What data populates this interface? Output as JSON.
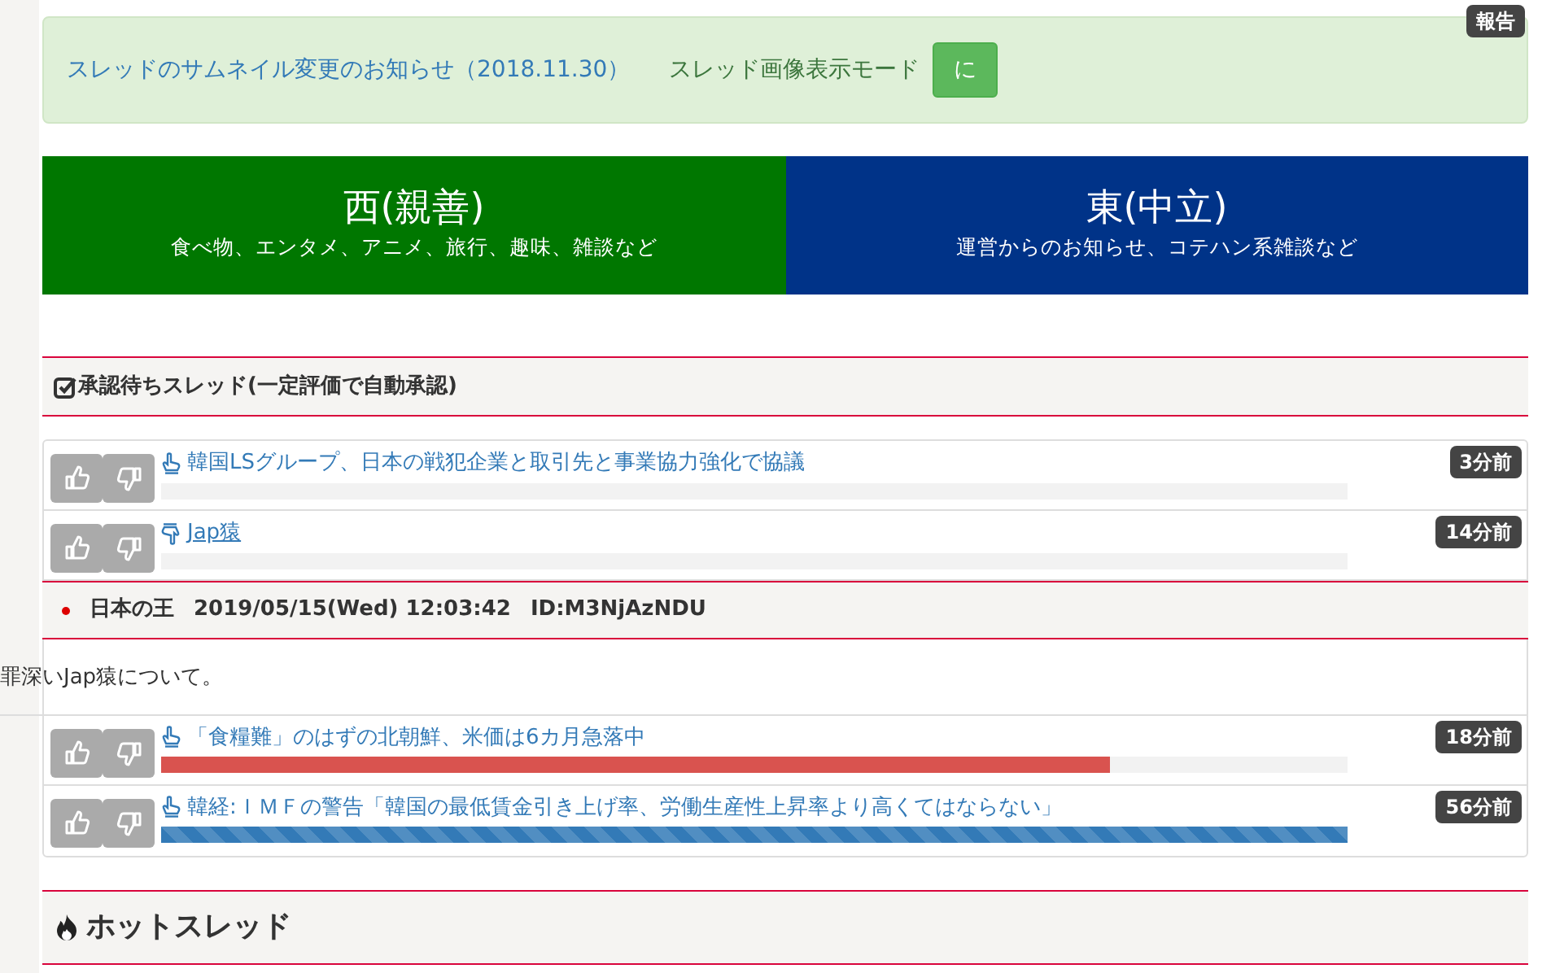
{
  "report_badge": "報告",
  "notice": {
    "link": "スレッドのサムネイル変更のお知らせ（2018.11.30）",
    "mode_label": "スレッド画像表示モード",
    "mode_button": "に"
  },
  "boards": [
    {
      "title": "西(親善)",
      "subtitle": "食べ物、エンタメ、アニメ、旅行、趣味、雑談など",
      "color": "#007700"
    },
    {
      "title": "東(中立)",
      "subtitle": "運営からのお知らせ、コテハン系雑談など",
      "color": "#003388"
    }
  ],
  "pending_section": {
    "title": "承認待ちスレッド(一定評価で自動承認)"
  },
  "threads": [
    {
      "title": "韓国LSグループ、日本の戦犯企業と取引先と事業協力強化で協議",
      "downvoted": false,
      "underlined": false,
      "time": "3分前",
      "level": 0
    },
    {
      "title": "Jap猿",
      "downvoted": true,
      "underlined": true,
      "time": "14分前",
      "level": 0,
      "comment": {
        "name": "日本の王",
        "date": "2019/05/15(Wed) 12:03:42",
        "id": "ID:M3NjAzNDU",
        "body": "罪深いJap猿について。"
      }
    },
    {
      "title": "「食糧難」のはずの北朝鮮、米価は6カ月急落中",
      "downvoted": false,
      "underlined": false,
      "time": "18分前",
      "level": 0.8,
      "color": "#d9534f",
      "striped": false
    },
    {
      "title": "韓経:ＩＭＦの警告「韓国の最低賃金引き上げ率、労働生産性上昇率より高くてはならない」",
      "downvoted": false,
      "underlined": false,
      "time": "56分前",
      "level": 1,
      "color": "#337ab7",
      "striped": true
    }
  ],
  "hot_section": {
    "title": "ホットスレッド"
  }
}
